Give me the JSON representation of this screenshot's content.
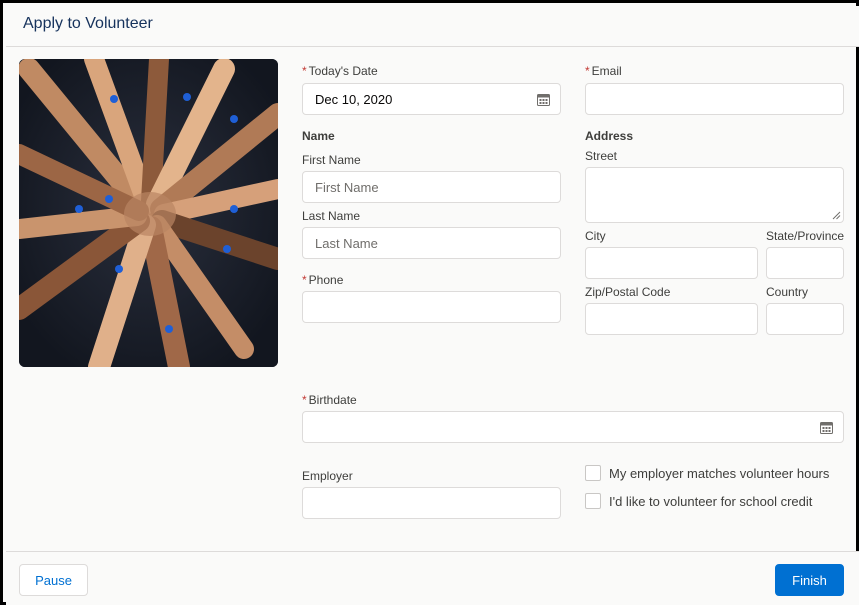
{
  "header": {
    "title": "Apply to Volunteer"
  },
  "form": {
    "todays_date": {
      "label": "Today's Date",
      "value": "Dec 10, 2020",
      "required_mark": "*"
    },
    "email": {
      "label": "Email",
      "value": "",
      "required_mark": "*"
    },
    "name_section": "Name",
    "first_name": {
      "label": "First Name",
      "placeholder": "First Name"
    },
    "last_name": {
      "label": "Last Name",
      "placeholder": "Last Name"
    },
    "phone": {
      "label": "Phone",
      "value": "",
      "required_mark": "*"
    },
    "address_section": "Address",
    "street": {
      "label": "Street",
      "value": ""
    },
    "city": {
      "label": "City",
      "value": ""
    },
    "state": {
      "label": "State/Province",
      "value": ""
    },
    "zip": {
      "label": "Zip/Postal Code",
      "value": ""
    },
    "country": {
      "label": "Country",
      "value": ""
    },
    "birthdate": {
      "label": "Birthdate",
      "value": "",
      "required_mark": "*"
    },
    "employer": {
      "label": "Employer",
      "value": ""
    },
    "checkboxes": [
      {
        "label": "My employer matches volunteer hours",
        "checked": false
      },
      {
        "label": "I'd like to volunteer for school credit",
        "checked": false
      }
    ]
  },
  "footer": {
    "pause_label": "Pause",
    "finish_label": "Finish"
  },
  "icons": {
    "calendar": "calendar-icon",
    "photo": "volunteer-hands-image"
  },
  "colors": {
    "brand": "#0070d2",
    "required": "#c23934",
    "title": "#16325c",
    "border": "#dddbda"
  }
}
